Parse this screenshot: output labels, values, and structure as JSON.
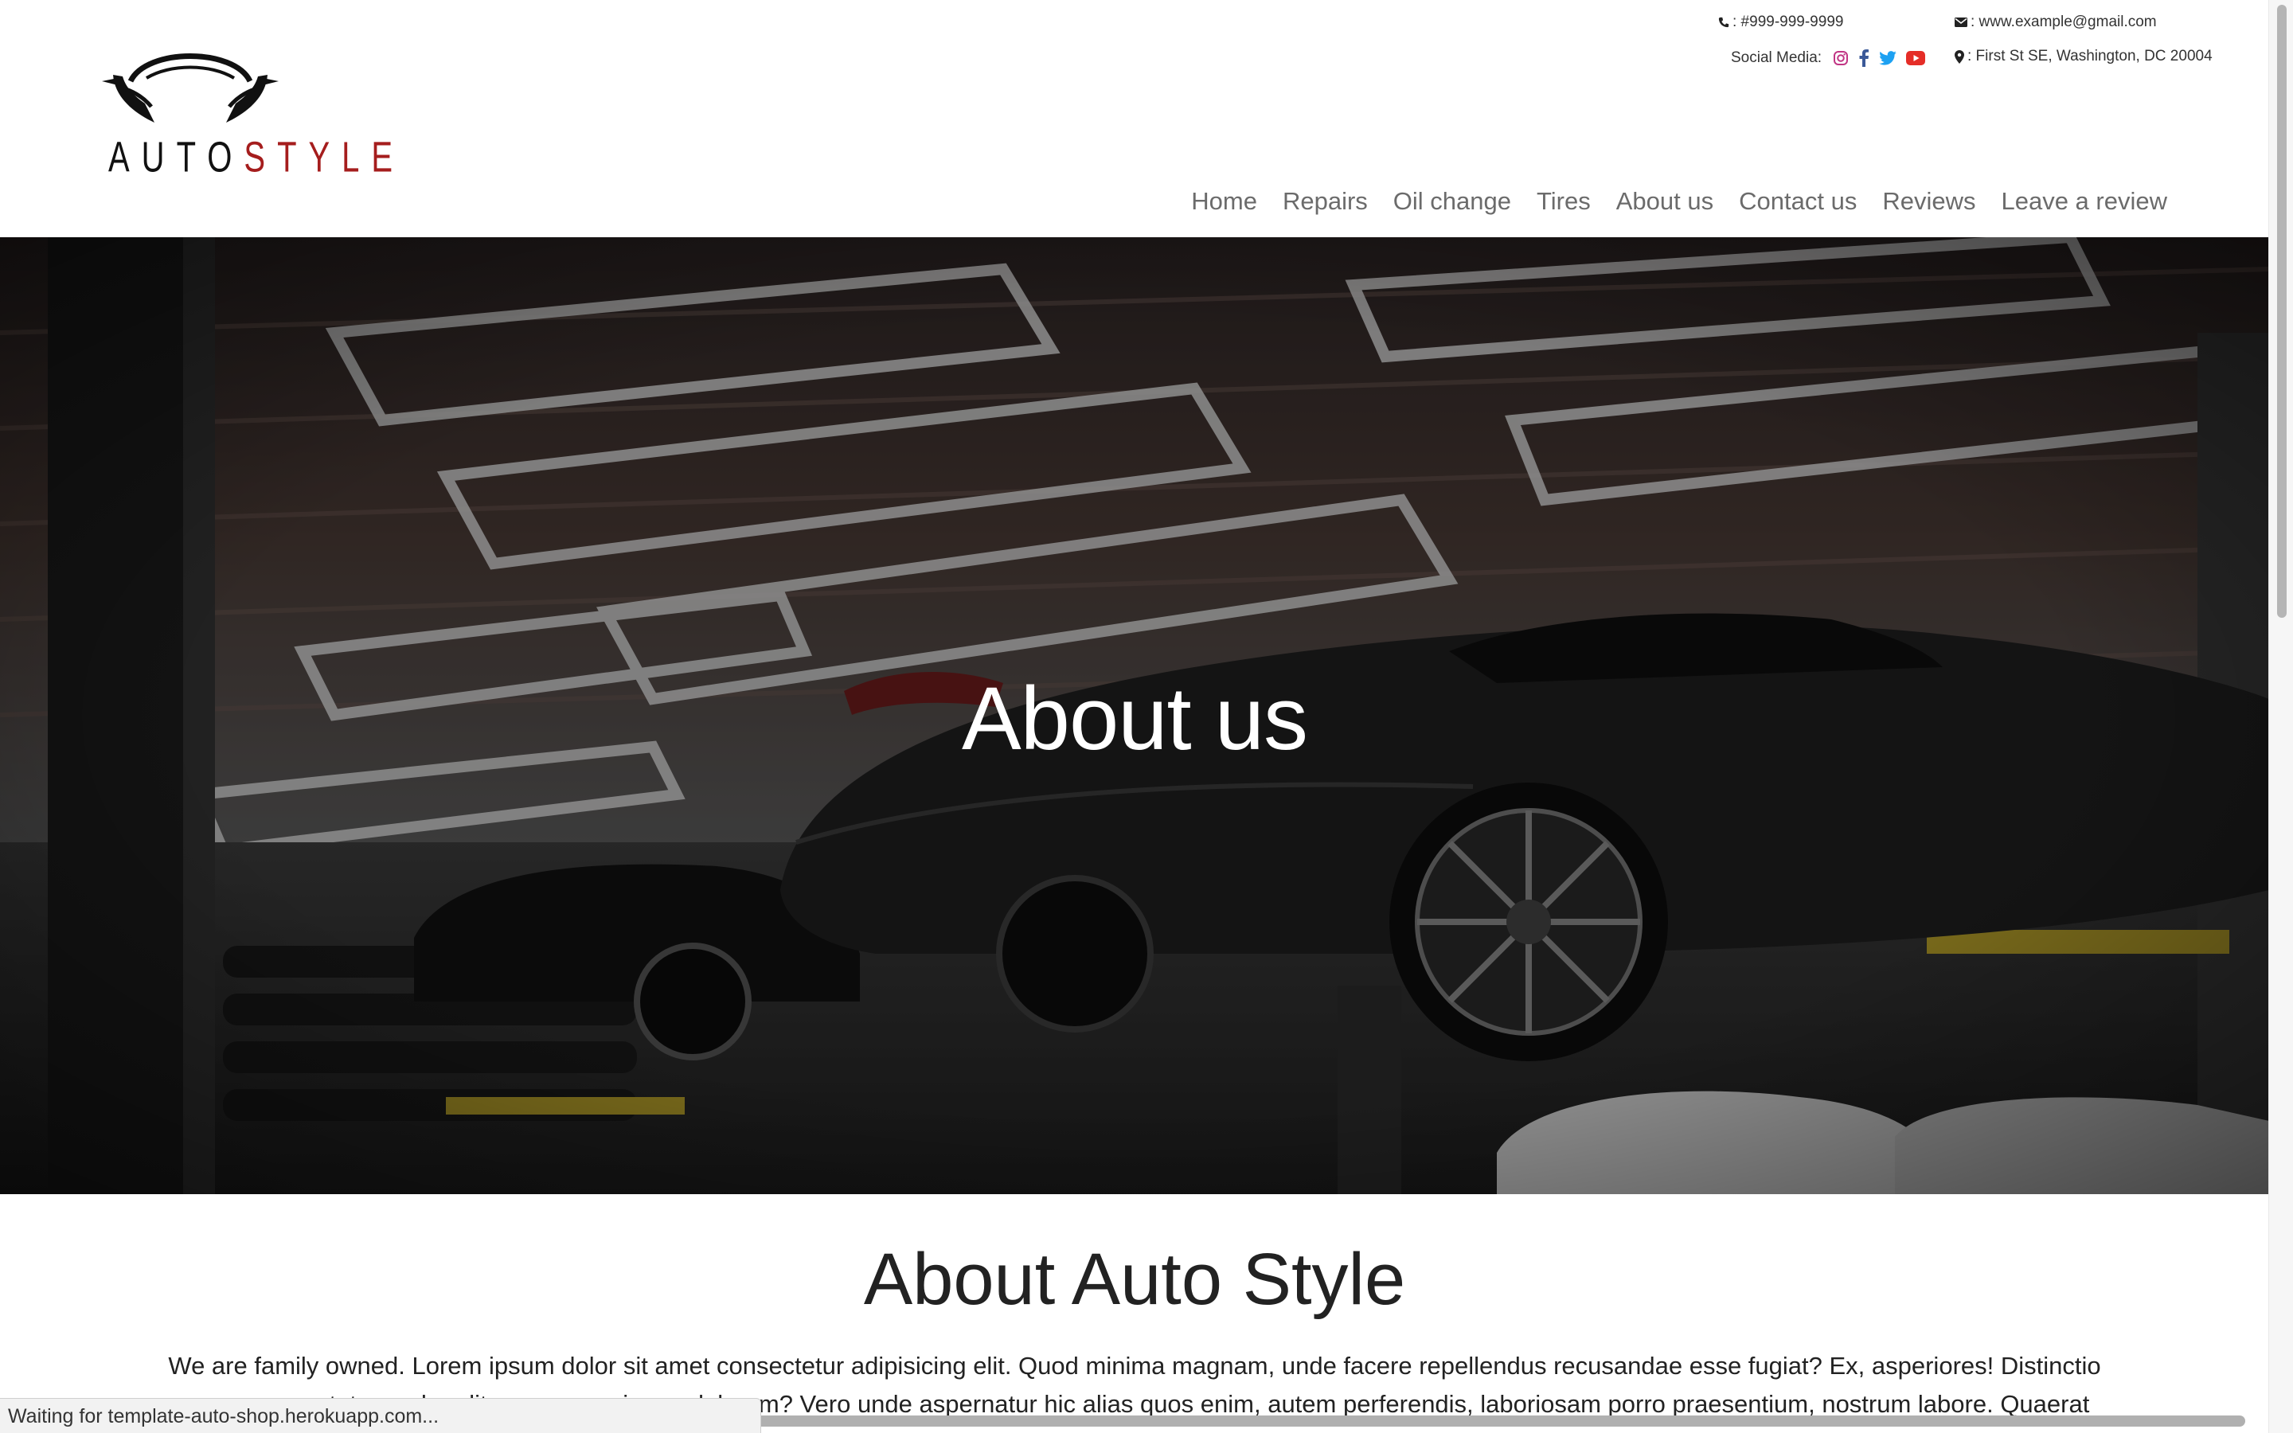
{
  "header": {
    "logo": {
      "text_main": "AUTO",
      "text_accent": "STYLE"
    },
    "contact": {
      "phone": ": #999-999-9999",
      "email": ": www.example@gmail.com",
      "address": ": First St SE, Washington, DC 20004",
      "social_label": "Social Media:",
      "social_icons": [
        "instagram-icon",
        "facebook-icon",
        "twitter-icon",
        "youtube-icon"
      ]
    },
    "nav": [
      {
        "label": "Home"
      },
      {
        "label": "Repairs"
      },
      {
        "label": "Oil change"
      },
      {
        "label": "Tires"
      },
      {
        "label": "About us"
      },
      {
        "label": "Contact us"
      },
      {
        "label": "Reviews"
      },
      {
        "label": "Leave a review"
      }
    ]
  },
  "hero": {
    "title": "About us"
  },
  "about": {
    "title": "About Auto Style",
    "text": "We are family owned. Lorem ipsum dolor sit amet consectetur adipisicing elit. Quod minima magnam, unde facere repellendus recusandae esse fugiat? Ex, asperiores! Distinctio rerum consectetur unde odit neque quasi eum dolorem? Vero unde aspernatur hic alias quos enim, autem perferendis, laboriosam porro praesentium, nostrum labore. Quaerat"
  },
  "status_bar": {
    "text": "Waiting for template-auto-shop.herokuapp.com..."
  },
  "colors": {
    "logo_accent": "#a51d1d",
    "nav_text": "#6b6b6b",
    "instagram": "#c13584",
    "facebook": "#3b5998",
    "twitter": "#1da1f2",
    "youtube": "#e52d27"
  }
}
